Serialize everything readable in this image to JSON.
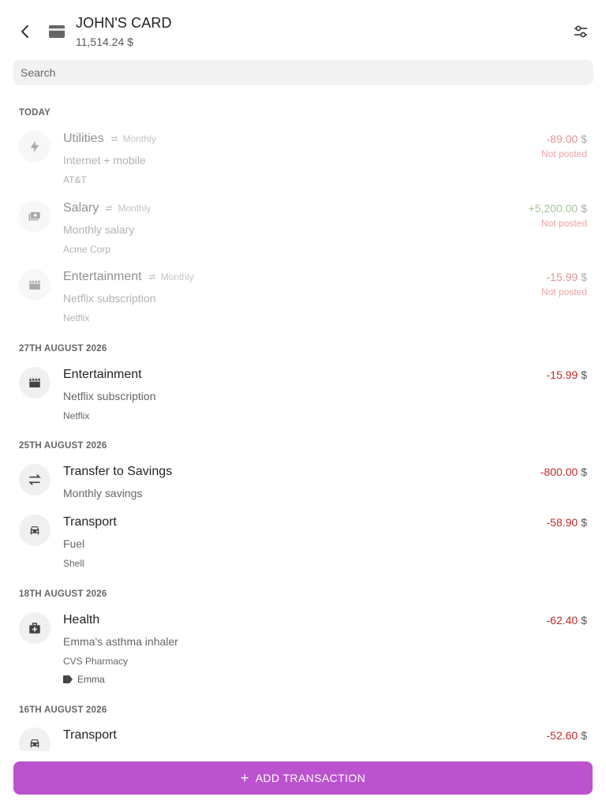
{
  "header": {
    "title": "JOHN'S CARD",
    "balance": "11,514.24 $",
    "back_icon": "arrow-left",
    "account_icon": "credit-card",
    "filter_icon": "tune-sliders"
  },
  "search": {
    "placeholder": "Search",
    "value": ""
  },
  "sections": [
    {
      "label": "TODAY"
    },
    {
      "label": "27TH AUGUST 2026"
    },
    {
      "label": "25TH AUGUST 2026"
    },
    {
      "label": "18TH AUGUST 2026"
    },
    {
      "label": "16TH AUGUST 2026"
    }
  ],
  "transactions": [
    {
      "category": "Utilities",
      "recurring": "Monthly",
      "description": "Internet + mobile",
      "payee": "AT&T",
      "amount": "-89.00",
      "currency": "$",
      "status": "Not posted",
      "icon": "bolt"
    },
    {
      "category": "Salary",
      "recurring": "Monthly",
      "description": "Monthly salary",
      "payee": "Acme Corp",
      "amount": "+5,200.00",
      "currency": "$",
      "status": "Not posted",
      "icon": "cash"
    },
    {
      "category": "Entertainment",
      "recurring": "Monthly",
      "description": "Netflix subscription",
      "payee": "Netflix",
      "amount": "-15.99",
      "currency": "$",
      "status": "Not posted",
      "icon": "movie-clapper"
    },
    {
      "category": "Entertainment",
      "description": "Netflix subscription",
      "payee": "Netflix",
      "amount": "-15.99",
      "currency": "$",
      "icon": "movie-clapper"
    },
    {
      "category": "Transfer to Savings",
      "description": "Monthly savings",
      "amount": "-800.00",
      "currency": "$",
      "icon": "swap-arrows"
    },
    {
      "category": "Transport",
      "description": "Fuel",
      "payee": "Shell",
      "amount": "-58.90",
      "currency": "$",
      "icon": "car"
    },
    {
      "category": "Health",
      "description": "Emma's asthma inhaler",
      "payee": "CVS Pharmacy",
      "tag": "Emma",
      "amount": "-62.40",
      "currency": "$",
      "icon": "medical-bag"
    },
    {
      "category": "Transport",
      "amount": "-52.60",
      "currency": "$",
      "icon": "car"
    }
  ],
  "add_button": {
    "label": "ADD TRANSACTION"
  },
  "colors": {
    "accent": "#bb53cf",
    "negative": "#c62828",
    "positive": "#558b2f",
    "not_posted": "#d84343"
  }
}
